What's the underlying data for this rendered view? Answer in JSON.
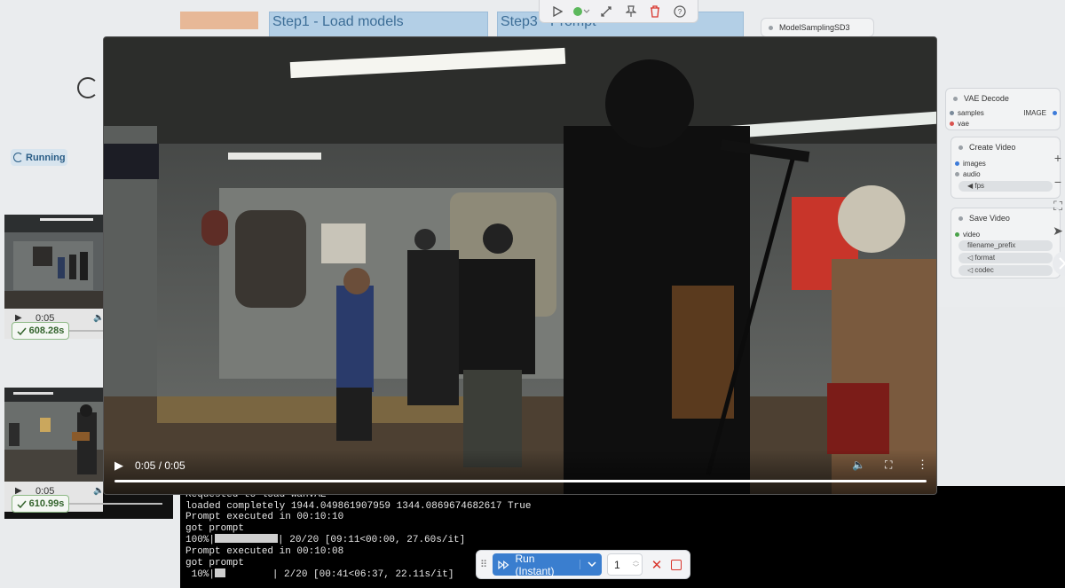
{
  "canvas": {
    "groups": [
      {
        "title": "Step1 - Load models"
      },
      {
        "title": "Step3 - Prompt"
      }
    ]
  },
  "toolbar": {
    "icons": [
      "play-icon",
      "status-dot-icon",
      "link-icon",
      "pin-icon",
      "trash-icon",
      "help-icon"
    ],
    "accent_green": "#5cb85c",
    "trash_color": "#d9342b"
  },
  "status": {
    "running_label": "Running"
  },
  "queue": [
    {
      "time": "0:05",
      "duration_badge": "608.28s"
    },
    {
      "time": "0:05",
      "duration_badge": "610.99s"
    }
  ],
  "nodes": {
    "model_sampling": {
      "title": "ModelSamplingSD3"
    },
    "vae_decode": {
      "title": "VAE Decode",
      "inputs": [
        "samples",
        "vae"
      ],
      "output": "IMAGE"
    },
    "create_video": {
      "title": "Create Video",
      "inputs": [
        "images",
        "audio"
      ],
      "widgets": [
        "fps"
      ]
    },
    "save_video": {
      "title": "Save Video",
      "inputs": [
        "video"
      ],
      "widgets": [
        "filename_prefix",
        "format",
        "codec"
      ]
    }
  },
  "video_player": {
    "time_display": "0:05 / 0:05",
    "progress": 1.0
  },
  "console": {
    "lines": [
      "Requested to load WanVAE",
      "loaded completely 1944.049861907959 1344.0869674682617 True",
      "Prompt executed in 00:10:10",
      "got prompt",
      "100%|",
      "Prompt executed in 00:10:08",
      "got prompt",
      " 10%|"
    ],
    "progress_full_suffix": "| 20/20 [09:11<00:00, 27.60s/it]",
    "progress_partial_suffix": "        | 2/20 [00:41<06:37, 22.11s/it]"
  },
  "runbar": {
    "run_label": "Run (Instant)",
    "count": "1",
    "run_color": "#3a7ecf"
  }
}
